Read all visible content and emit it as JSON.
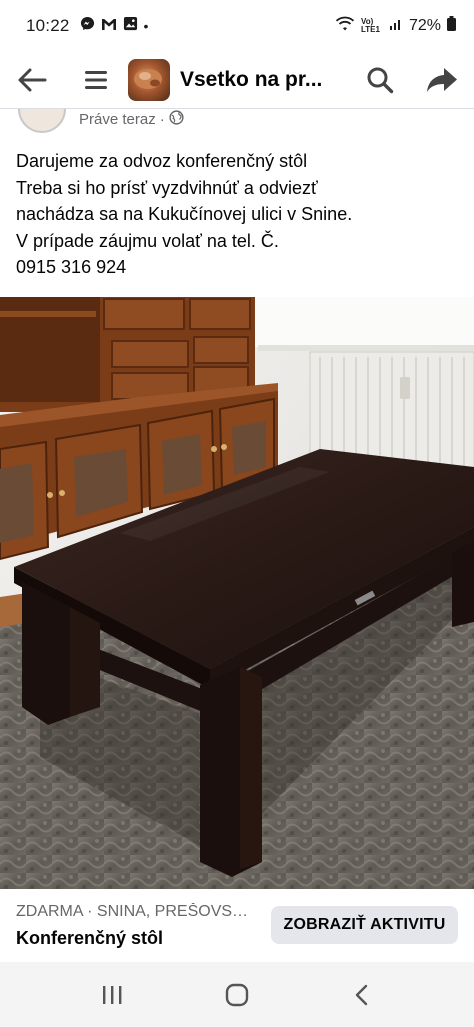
{
  "status_bar": {
    "time": "10:22",
    "notification_icons": [
      "messenger-icon",
      "gmail-icon",
      "gallery-icon"
    ],
    "dot": "•",
    "network_label": "Vo) LTE1",
    "battery": "72%"
  },
  "header": {
    "title": "Vsetko na pr...",
    "icons": [
      "back-arrow-icon",
      "menu-icon",
      "search-icon",
      "share-icon"
    ]
  },
  "post": {
    "time": "Práve teraz",
    "separator": "·",
    "privacy_icon": "globe-icon",
    "lines": [
      "Darujeme za odvoz konferenčný stôl",
      "Treba si ho prísť vyzdvihnúť a odviezť",
      "nachádza sa na Kukučínovej ulici v Snine.",
      "V prípade záujmu volať na tel. Č.",
      "0915 316 924"
    ]
  },
  "listing": {
    "location": "ZDARMA · SNINA, PREŠOVSK...",
    "title": "Konferenčný stôl",
    "cta": "ZOBRAZIŤ AKTIVITU"
  },
  "nav": {
    "icons": [
      "recents-icon",
      "home-icon",
      "back-icon"
    ]
  },
  "colors": {
    "text": "#050505",
    "secondary": "#65676b",
    "button_bg": "#e4e6eb"
  }
}
